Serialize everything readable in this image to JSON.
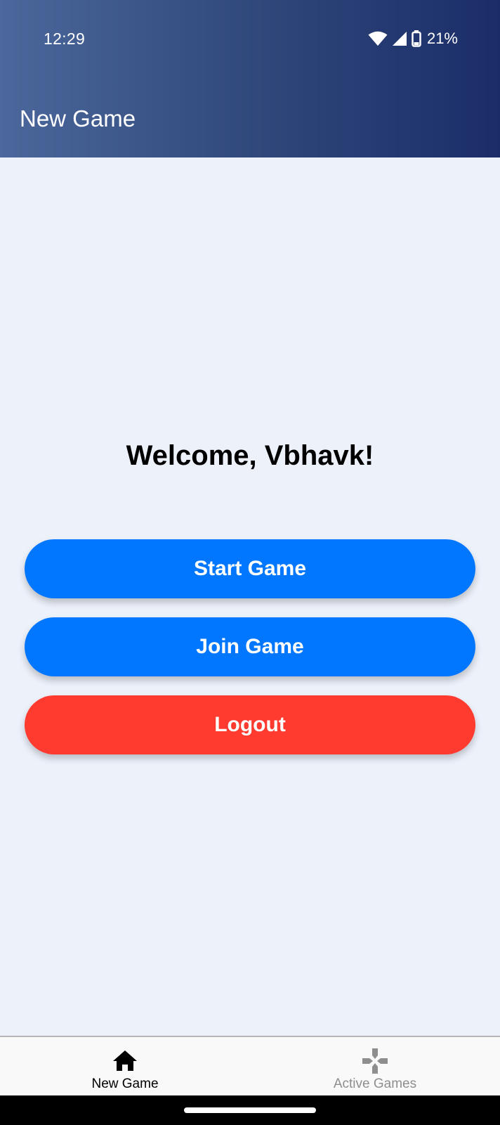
{
  "status_bar": {
    "time": "12:29",
    "battery_percent": "21%",
    "icons": [
      "wifi-icon",
      "signal-icon",
      "battery-icon"
    ]
  },
  "header": {
    "title": "New Game",
    "gradient_colors": [
      "#4b679b",
      "#1b2d69"
    ]
  },
  "main": {
    "welcome_text": "Welcome, Vbhavk!",
    "buttons": [
      {
        "label": "Start Game",
        "color": "#0177ff"
      },
      {
        "label": "Join Game",
        "color": "#0177ff"
      },
      {
        "label": "Logout",
        "color": "#ff3b30"
      }
    ]
  },
  "bottom_nav": {
    "items": [
      {
        "label": "New Game",
        "icon": "home-icon",
        "active": true
      },
      {
        "label": "Active Games",
        "icon": "gamepad-icon",
        "active": false
      }
    ]
  },
  "colors": {
    "background": "#edf1fa",
    "nav_active": "#000000",
    "nav_inactive": "#8e8e8e"
  }
}
